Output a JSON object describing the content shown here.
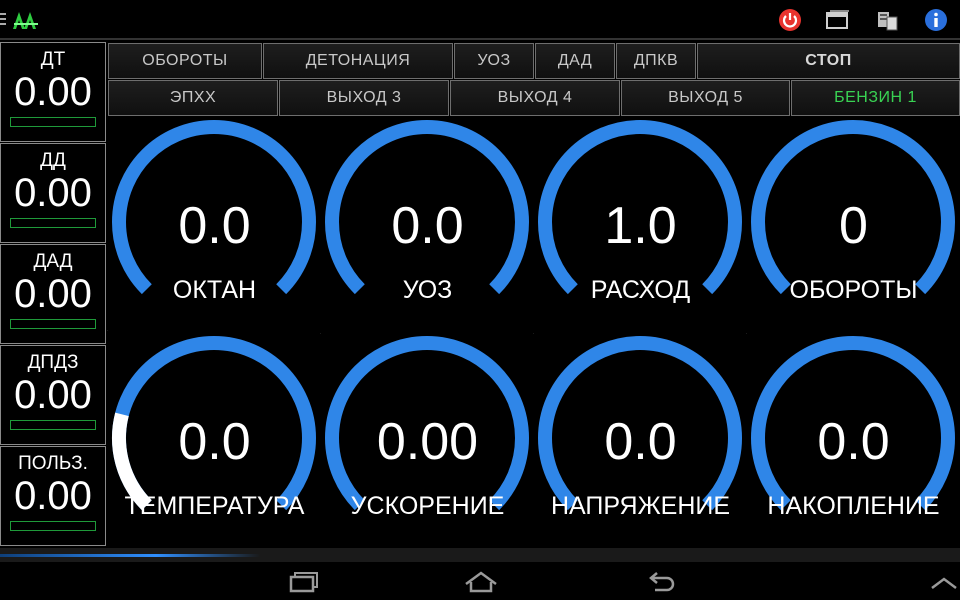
{
  "actionbar": {
    "icons": [
      "overflow-handle-icon",
      "app-logo-icon",
      "power-icon",
      "windows-icon",
      "device-icon",
      "info-icon"
    ],
    "colors": {
      "power": "#e8332e",
      "info": "#2a6fdc",
      "logo": "#2ecc40"
    }
  },
  "sensors": [
    {
      "label": "ДТ",
      "value": "0.00"
    },
    {
      "label": "ДД",
      "value": "0.00"
    },
    {
      "label": "ДАД",
      "value": "0.00"
    },
    {
      "label": "ДПДЗ",
      "value": "0.00"
    },
    {
      "label": "ПОЛЬЗ.",
      "value": "0.00"
    }
  ],
  "buttons_row1": [
    {
      "label": "ОБОРОТЫ"
    },
    {
      "label": "ДЕТОНАЦИЯ"
    },
    {
      "label": "УОЗ"
    },
    {
      "label": "ДАД"
    },
    {
      "label": "ДПКВ"
    },
    {
      "label": "СТОП"
    }
  ],
  "buttons_row2": [
    {
      "label": "ЭПХХ"
    },
    {
      "label": "ВЫХОД 3"
    },
    {
      "label": "ВЫХОД 4"
    },
    {
      "label": "ВЫХОД 5"
    },
    {
      "label": "БЕНЗИН 1",
      "active": true
    }
  ],
  "gauges": [
    {
      "name": "ОКТАН",
      "value": "0.0"
    },
    {
      "name": "УОЗ",
      "value": "0.0"
    },
    {
      "name": "РАСХОД",
      "value": "1.0"
    },
    {
      "name": "ОБОРОТЫ",
      "value": "0"
    },
    {
      "name": "ТЕМПЕРАТУРА",
      "value": "0.0",
      "level": 0.22
    },
    {
      "name": "УСКОРЕНИЕ",
      "value": "0.00"
    },
    {
      "name": "НАПРЯЖЕНИЕ",
      "value": "0.0"
    },
    {
      "name": "НАКОПЛЕНИЕ",
      "value": "0.0"
    }
  ],
  "colors": {
    "arc": "#2f86e8",
    "arc_fill": "#ffffff",
    "active_text": "#39d353",
    "bar_border": "#1f9a3a"
  },
  "navbar": {
    "icons": [
      "recents-icon",
      "home-icon",
      "back-icon",
      "up-chevron-icon"
    ]
  }
}
